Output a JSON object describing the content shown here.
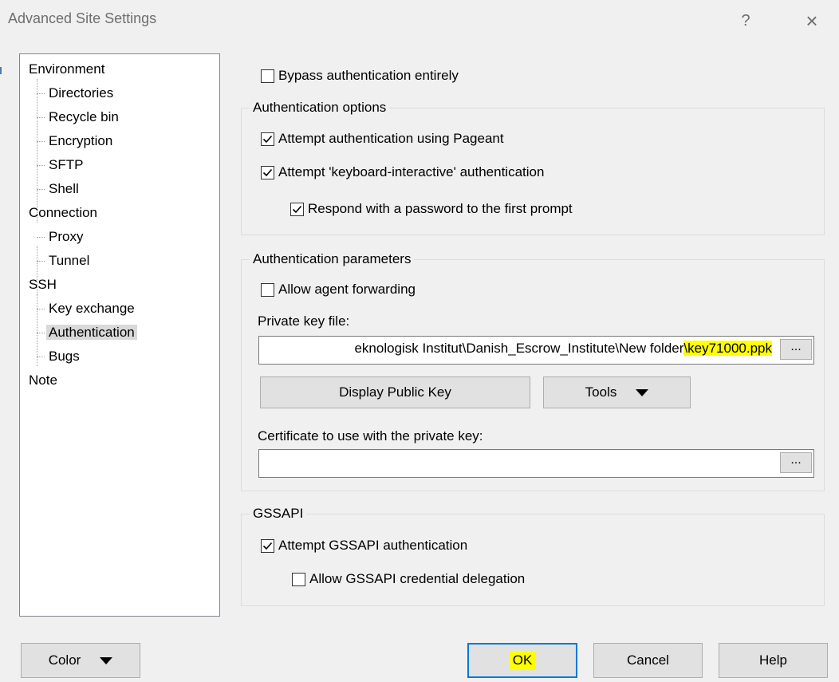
{
  "window": {
    "title": "Advanced Site Settings",
    "help_glyph": "?",
    "close_glyph": "×"
  },
  "tree": {
    "items": [
      {
        "label": "Environment"
      },
      {
        "label": "Directories"
      },
      {
        "label": "Recycle bin"
      },
      {
        "label": "Encryption"
      },
      {
        "label": "SFTP"
      },
      {
        "label": "Shell"
      },
      {
        "label": "Connection"
      },
      {
        "label": "Proxy"
      },
      {
        "label": "Tunnel"
      },
      {
        "label": "SSH"
      },
      {
        "label": "Key exchange"
      },
      {
        "label": "Authentication",
        "selected": true
      },
      {
        "label": "Bugs"
      },
      {
        "label": "Note"
      }
    ]
  },
  "bypass": {
    "label": "Bypass authentication entirely",
    "checked": false
  },
  "auth_options": {
    "title": "Authentication options",
    "pageant": {
      "label": "Attempt authentication using Pageant",
      "checked": true
    },
    "keyboard_interactive": {
      "label": "Attempt 'keyboard-interactive' authentication",
      "checked": true
    },
    "respond_password": {
      "label": "Respond with a password to the first prompt",
      "checked": true
    }
  },
  "auth_params": {
    "title": "Authentication parameters",
    "agent_forwarding": {
      "label": "Allow agent forwarding",
      "checked": false
    },
    "private_key_label": "Private key file:",
    "private_key_prefix": "eknologisk Institut\\Danish_Escrow_Institute\\New folder",
    "private_key_highlight": "\\key71000.ppk",
    "browse_label": "...",
    "display_public_key": "Display Public Key",
    "tools_label": "Tools",
    "certificate_label": "Certificate to use with the private key:",
    "certificate_value": "",
    "certificate_browse_label": "..."
  },
  "gssapi": {
    "title": "GSSAPI",
    "attempt": {
      "label": "Attempt GSSAPI authentication",
      "checked": true
    },
    "delegation": {
      "label": "Allow GSSAPI credential delegation",
      "checked": false
    }
  },
  "footer": {
    "color_label": "Color",
    "ok_label": "OK",
    "cancel_label": "Cancel",
    "help_label": "Help"
  },
  "colors": {
    "highlight": "#ffff00",
    "default_button_border": "#0078d7",
    "selection": "#d9d9d9"
  }
}
